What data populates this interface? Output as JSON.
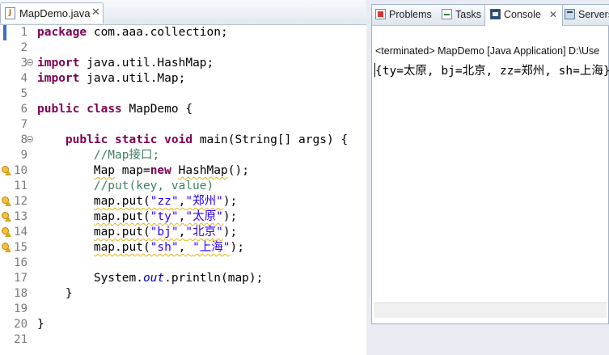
{
  "editor": {
    "tab_label": "MapDemo.java",
    "tab_close": "✕",
    "file_icon": "J",
    "lines": [
      {
        "n": "1",
        "code": [
          {
            "t": "package",
            "c": "kw"
          },
          {
            "t": " com.aaa.collection;"
          }
        ]
      },
      {
        "n": "2",
        "code": []
      },
      {
        "n": "3",
        "code": [
          {
            "t": "import",
            "c": "kw"
          },
          {
            "t": " java.util.HashMap;"
          }
        ],
        "fold": true
      },
      {
        "n": "4",
        "code": [
          {
            "t": "import",
            "c": "kw"
          },
          {
            "t": " java.util.Map;"
          }
        ]
      },
      {
        "n": "5",
        "code": []
      },
      {
        "n": "6",
        "code": [
          {
            "t": "public",
            "c": "kw"
          },
          {
            "t": " "
          },
          {
            "t": "class",
            "c": "kw"
          },
          {
            "t": " MapDemo {"
          }
        ]
      },
      {
        "n": "7",
        "code": []
      },
      {
        "n": "8",
        "code": [
          {
            "t": "    "
          },
          {
            "t": "public",
            "c": "kw"
          },
          {
            "t": " "
          },
          {
            "t": "static",
            "c": "kw"
          },
          {
            "t": " "
          },
          {
            "t": "void",
            "c": "kw"
          },
          {
            "t": " main(String[] args) {"
          }
        ],
        "fold": true
      },
      {
        "n": "9",
        "code": [
          {
            "t": "        "
          },
          {
            "t": "//Map接口;",
            "c": "cmt"
          }
        ]
      },
      {
        "n": "10",
        "code": [
          {
            "t": "        "
          },
          {
            "t": "Map",
            "c": "squig"
          },
          {
            "t": " map="
          },
          {
            "t": "new",
            "c": "kw"
          },
          {
            "t": " "
          },
          {
            "t": "HashMap",
            "c": "squig"
          },
          {
            "t": "();"
          }
        ],
        "warn": true
      },
      {
        "n": "11",
        "code": [
          {
            "t": "        "
          },
          {
            "t": "//put(key, value)",
            "c": "cmt"
          }
        ]
      },
      {
        "n": "12",
        "code": [
          {
            "t": "        "
          },
          {
            "t": "map.put(",
            "c": "squig"
          },
          {
            "t": "\"zz\"",
            "c": "str squig"
          },
          {
            "t": ",",
            "c": "squig"
          },
          {
            "t": "\"郑州\"",
            "c": "str squig"
          },
          {
            "t": ");"
          }
        ],
        "warn": true
      },
      {
        "n": "13",
        "code": [
          {
            "t": "        "
          },
          {
            "t": "map.put(",
            "c": "squig"
          },
          {
            "t": "\"ty\"",
            "c": "str squig"
          },
          {
            "t": ",",
            "c": "squig"
          },
          {
            "t": "\"太原\"",
            "c": "str squig"
          },
          {
            "t": ");"
          }
        ],
        "warn": true
      },
      {
        "n": "14",
        "code": [
          {
            "t": "        "
          },
          {
            "t": "map.put(",
            "c": "squig"
          },
          {
            "t": "\"bj\"",
            "c": "str squig"
          },
          {
            "t": ",",
            "c": "squig"
          },
          {
            "t": "\"北京\"",
            "c": "str squig"
          },
          {
            "t": ");"
          }
        ],
        "warn": true
      },
      {
        "n": "15",
        "code": [
          {
            "t": "        "
          },
          {
            "t": "map.put(",
            "c": "squig"
          },
          {
            "t": "\"sh\"",
            "c": "str squig"
          },
          {
            "t": ", ",
            "c": "squig"
          },
          {
            "t": "\"上海\"",
            "c": "str squig"
          },
          {
            "t": ");"
          }
        ],
        "warn": true
      },
      {
        "n": "16",
        "code": []
      },
      {
        "n": "17",
        "code": [
          {
            "t": "        System."
          },
          {
            "t": "out",
            "c": "fld"
          },
          {
            "t": ".println(map);"
          }
        ]
      },
      {
        "n": "18",
        "code": [
          {
            "t": "    }"
          }
        ]
      },
      {
        "n": "19",
        "code": []
      },
      {
        "n": "20",
        "code": [
          {
            "t": "}"
          }
        ]
      },
      {
        "n": "21",
        "code": []
      }
    ]
  },
  "views": {
    "tabs": [
      {
        "label": "Problems",
        "icon": "problems-icon"
      },
      {
        "label": "Tasks",
        "icon": "tasks-icon"
      },
      {
        "label": "Console",
        "icon": "console-icon",
        "active": true,
        "close": "✕"
      },
      {
        "label": "Servers",
        "icon": "servers-icon"
      }
    ],
    "console": {
      "terminated": "<terminated> MapDemo [Java Application] D:\\Use",
      "output": "{ty=太原, bj=北京, zz=郑州, sh=上海}"
    }
  },
  "colors": {
    "keyword": "#7f0055",
    "string": "#2a00ff",
    "comment": "#3f7f5f",
    "field": "#0000c0"
  }
}
